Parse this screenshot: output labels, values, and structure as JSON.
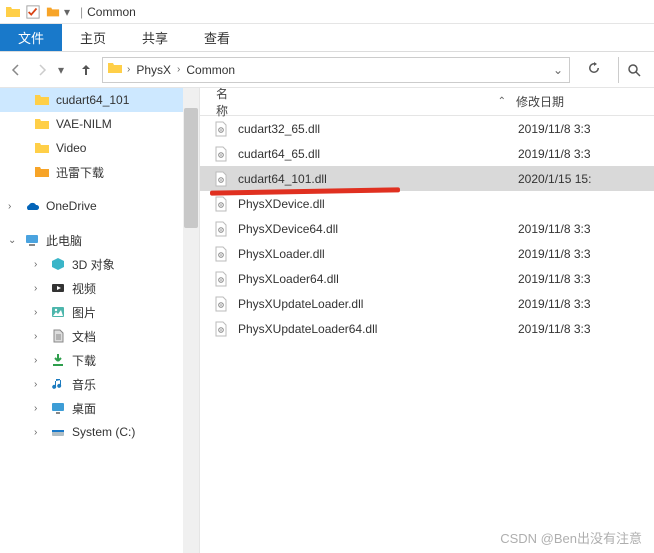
{
  "titlebar": {
    "title": "Common"
  },
  "ribbon": {
    "file": "文件",
    "home": "主页",
    "share": "共享",
    "view": "查看"
  },
  "breadcrumb": {
    "item1": "PhysX",
    "item2": "Common"
  },
  "columns": {
    "name": "名称",
    "date": "修改日期"
  },
  "sidebar": {
    "items": [
      {
        "label": "cudart64_101"
      },
      {
        "label": "VAE-NILM"
      },
      {
        "label": "Video"
      },
      {
        "label": "迅雷下载"
      },
      {
        "label": "OneDrive"
      },
      {
        "label": "此电脑"
      },
      {
        "label": "3D 对象"
      },
      {
        "label": "视频"
      },
      {
        "label": "图片"
      },
      {
        "label": "文档"
      },
      {
        "label": "下载"
      },
      {
        "label": "音乐"
      },
      {
        "label": "桌面"
      },
      {
        "label": "System (C:)"
      }
    ]
  },
  "files": [
    {
      "name": "cudart32_65.dll",
      "date": "2019/11/8 3:3",
      "sel": false
    },
    {
      "name": "cudart64_65.dll",
      "date": "2019/11/8 3:3",
      "sel": false
    },
    {
      "name": "cudart64_101.dll",
      "date": "2020/1/15 15:",
      "sel": true
    },
    {
      "name": "PhysXDevice.dll",
      "date": "",
      "sel": false
    },
    {
      "name": "PhysXDevice64.dll",
      "date": "2019/11/8 3:3",
      "sel": false
    },
    {
      "name": "PhysXLoader.dll",
      "date": "2019/11/8 3:3",
      "sel": false
    },
    {
      "name": "PhysXLoader64.dll",
      "date": "2019/11/8 3:3",
      "sel": false
    },
    {
      "name": "PhysXUpdateLoader.dll",
      "date": "2019/11/8 3:3",
      "sel": false
    },
    {
      "name": "PhysXUpdateLoader64.dll",
      "date": "2019/11/8 3:3",
      "sel": false
    }
  ],
  "watermark": "CSDN @Ben出没有注意"
}
